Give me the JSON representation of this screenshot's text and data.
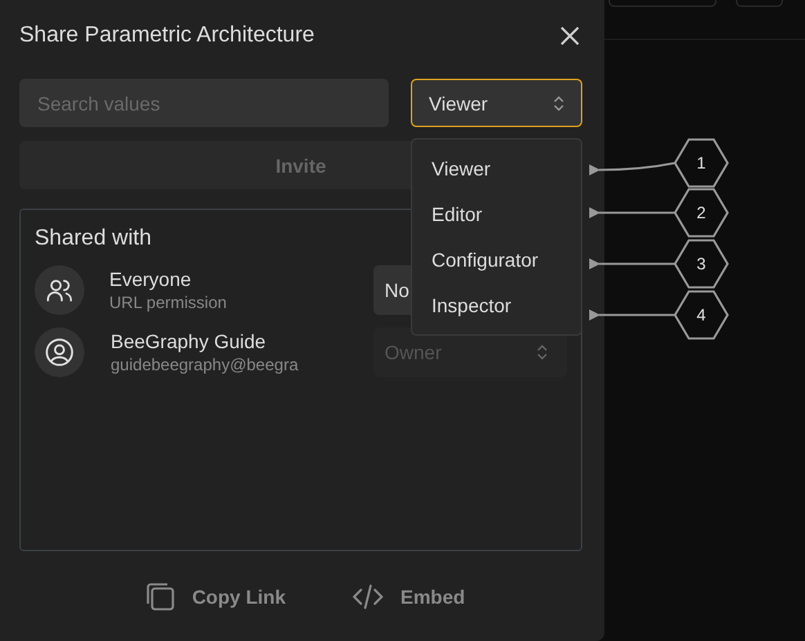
{
  "dialog": {
    "title": "Share Parametric Architecture"
  },
  "search": {
    "placeholder": "Search values"
  },
  "role_select": {
    "value": "Viewer",
    "open": true
  },
  "invite_button": {
    "label": "Invite",
    "disabled": true
  },
  "shared_with": {
    "title": "Shared with",
    "members": [
      {
        "kind": "group",
        "name": "Everyone",
        "detail": "URL permission",
        "role": "No",
        "disabled": false
      },
      {
        "kind": "user",
        "name": "BeeGraphy Guide",
        "detail": "guidebeegraphy@beegra",
        "role": "Owner",
        "disabled": true
      }
    ]
  },
  "role_menu": {
    "options": [
      {
        "label": "Viewer",
        "selected": false
      },
      {
        "label": "Editor",
        "selected": false
      },
      {
        "label": "Configurator",
        "selected": false
      },
      {
        "label": "Inspector",
        "selected": false
      }
    ]
  },
  "callouts": [
    "1",
    "2",
    "3",
    "4"
  ],
  "actions": [
    {
      "kind": "copy",
      "label": "Copy Link"
    },
    {
      "kind": "embed",
      "label": "Embed"
    }
  ]
}
